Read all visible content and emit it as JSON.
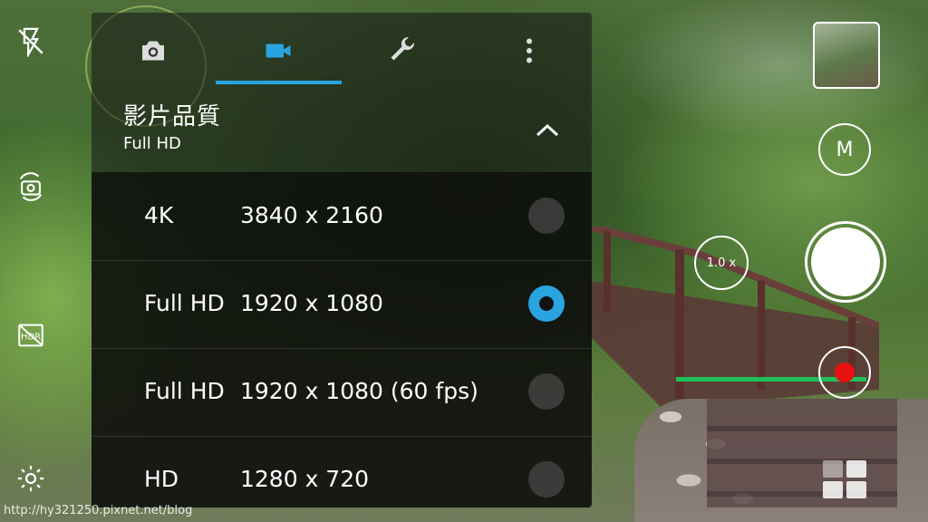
{
  "camera": {
    "icons": {
      "flash": "flash-off-icon",
      "switch_camera": "switch-camera-icon",
      "hdr": "hdr-off-icon",
      "settings": "gear-icon"
    },
    "zoom_label": "1.0 x",
    "mode_label": "M",
    "watermark": "http://hy321250.pixnet.net/blog"
  },
  "panel": {
    "tabs": [
      {
        "name": "photo",
        "icon": "camera-icon",
        "active": false
      },
      {
        "name": "video",
        "icon": "video-camera-icon",
        "active": true
      },
      {
        "name": "tools",
        "icon": "wrench-icon",
        "active": false
      },
      {
        "name": "more",
        "icon": "more-vertical-icon",
        "active": false
      }
    ],
    "setting": {
      "title": "影片品質",
      "value": "Full HD"
    },
    "options": [
      {
        "name": "4K",
        "resolution": "3840 x 2160",
        "selected": false
      },
      {
        "name": "Full HD",
        "resolution": "1920 x 1080",
        "selected": true
      },
      {
        "name": "Full HD",
        "resolution": "1920 x 1080 (60 fps)",
        "selected": false
      },
      {
        "name": "HD",
        "resolution": "1280 x 720",
        "selected": false
      }
    ]
  },
  "colors": {
    "accent": "#2aa4e0",
    "record": "#e81010",
    "record_progress": "#1fbf5a"
  }
}
